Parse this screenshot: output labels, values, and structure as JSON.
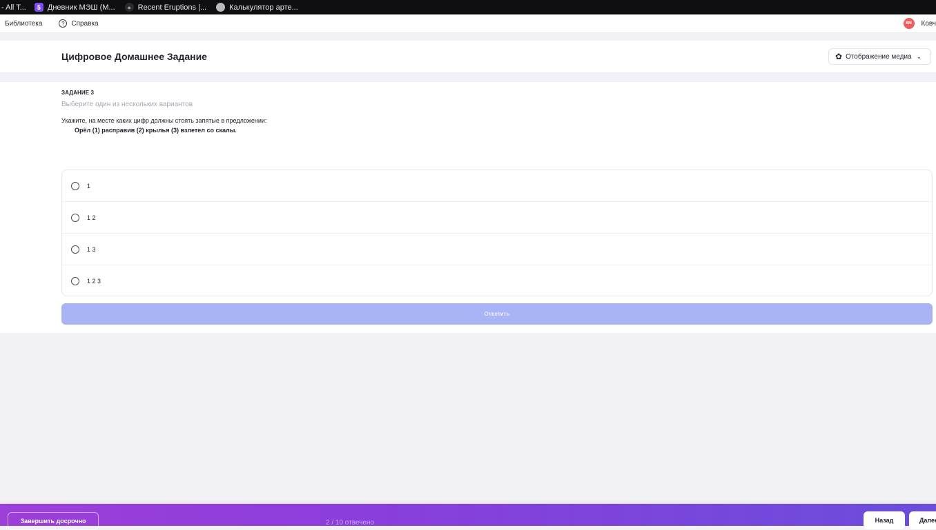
{
  "bookmarks": [
    {
      "label": "- All T...",
      "icon": "none"
    },
    {
      "label": "Дневник МЭШ (М...",
      "icon": "mesh-5-icon"
    },
    {
      "label": "Recent Eruptions |...",
      "icon": "globe-icon"
    },
    {
      "label": "Калькулятор арте...",
      "icon": "moon-icon"
    }
  ],
  "appbar": {
    "library": "Библиотека",
    "help": "Справка",
    "user_initials": "КМ",
    "user_name": "Ковч"
  },
  "header": {
    "title": "Цифровое Домашнее Задание",
    "media_label": "Отображение медиа"
  },
  "task": {
    "number": "ЗАДАНИЕ 3",
    "hint": "Выберите один из нескольких вариантов",
    "question": "Укажите, на месте каких цифр должны стоять запятые в предложении:",
    "sentence": "Орёл (1) расправив (2) крылья (3) взлетел со скалы."
  },
  "options": [
    {
      "label": "1"
    },
    {
      "label": "1 2"
    },
    {
      "label": "1 3"
    },
    {
      "label": "1 2 3"
    }
  ],
  "answer_label": "Ответить",
  "footer": {
    "finish_label": "Завершить досрочно",
    "progress": "2 / 10 отвечено",
    "back_label": "Назад",
    "next_label": "Далее"
  },
  "colors": {
    "accent": "#a8b4f6",
    "gradient_start": "#9d3fd9",
    "gradient_end": "#6b4ddc",
    "avatar": "#ee5d5d"
  }
}
